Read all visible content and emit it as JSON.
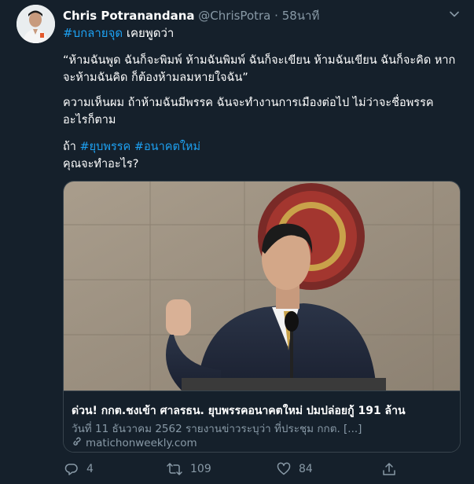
{
  "user": {
    "name": "Chris Potranandana",
    "handle": "@ChrisPotra",
    "separator": "·",
    "time": "58นาที"
  },
  "intro": {
    "hashtag": "#บกลายจุด",
    "text": " เคยพูดว่า"
  },
  "body": {
    "quote": "“ห้ามฉันพูด ฉันก็จะพิมพ์ ห้ามฉันพิมพ์ ฉันก็จะเขียน ห้ามฉันเขียน ฉันก็จะคิด หากจะห้ามฉันคิด ก็ต้องห้ามลมหายใจฉัน”",
    "opinion": "ความเห็นผม ถ้าห้ามฉันมีพรรค ฉันจะทำงานการเมืองต่อไป ไม่ว่าจะชื่อพรรคอะไรก็ตาม",
    "if_prefix": "ถ้า ",
    "tag1": "#ยุบพรรค",
    "tag2": "#อนาคตใหม่",
    "question": "คุณจะทำอะไร?"
  },
  "card": {
    "title": "ด่วน! กกต.ชงเข้า ศาลรธน. ยุบพรรคอนาคตใหม่ ปมปล่อยกู้ 191 ล้าน",
    "description": "วันที่ 11 ธันวาคม 2562 รายงานข่าวระบุว่า ที่ประชุม กกต. [...]",
    "domain": "matichonweekly.com"
  },
  "actions": {
    "replies": "4",
    "retweets": "109",
    "likes": "84"
  },
  "colors": {
    "background": "#15202b",
    "accent": "#1da1f2",
    "secondary_text": "#8899a6",
    "border": "#38444d"
  },
  "icons": {
    "chevron": "chevron-down-icon",
    "reply": "reply-icon",
    "retweet": "retweet-icon",
    "like": "heart-icon",
    "share": "share-icon",
    "link": "link-icon"
  }
}
